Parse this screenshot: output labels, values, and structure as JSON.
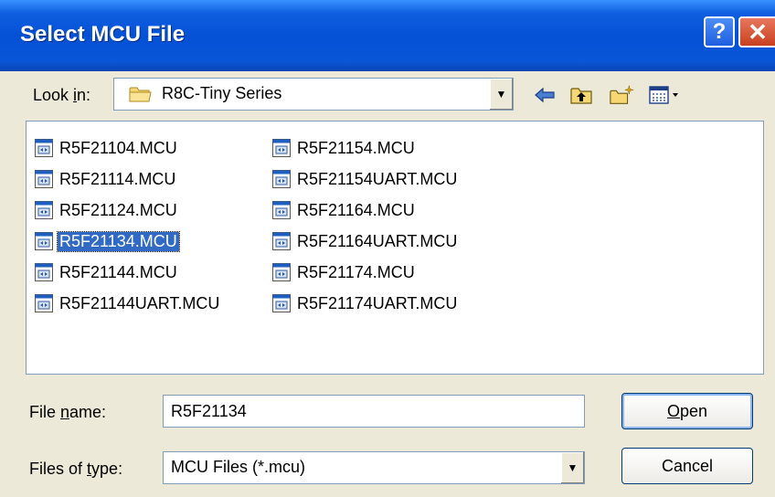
{
  "window": {
    "title": "Select MCU File",
    "help_glyph": "?",
    "close_glyph": "✕"
  },
  "lookin": {
    "label": "Look in:",
    "value": "R8C-Tiny Series",
    "icon": "folder-icon"
  },
  "toolbar": {
    "icons": [
      "back-icon",
      "up-folder-icon",
      "new-folder-icon",
      "view-menu-icon"
    ]
  },
  "files": {
    "column1": [
      "R5F21104.MCU",
      "R5F21114.MCU",
      "R5F21124.MCU",
      "R5F21134.MCU",
      "R5F21144.MCU",
      "R5F21144UART.MCU"
    ],
    "column2": [
      "R5F21154.MCU",
      "R5F21154UART.MCU",
      "R5F21164.MCU",
      "R5F21164UART.MCU",
      "R5F21174.MCU",
      "R5F21174UART.MCU"
    ],
    "selected": "R5F21134.MCU"
  },
  "filename": {
    "label": "File name:",
    "value": "R5F21134"
  },
  "filetype": {
    "label": "Files of type:",
    "value": "MCU Files (*.mcu)"
  },
  "buttons": {
    "open": "Open",
    "cancel": "Cancel"
  },
  "colors": {
    "titlebar": "#0551D6",
    "selection": "#316AC5",
    "dialog_bg": "#ECE9D8"
  }
}
